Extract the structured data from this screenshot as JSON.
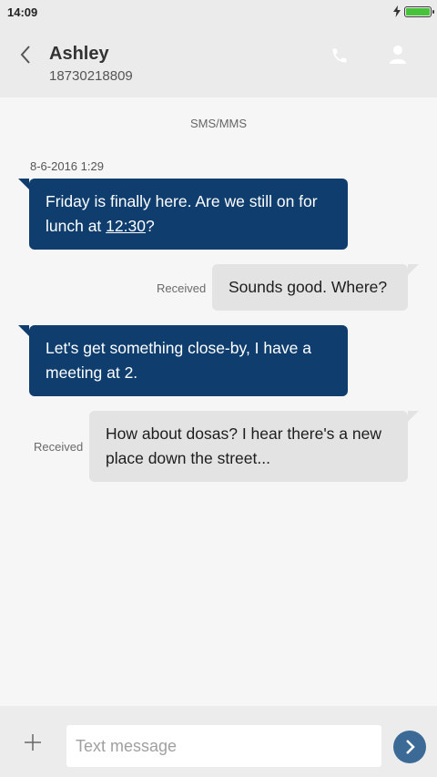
{
  "status_bar": {
    "time": "14:09",
    "battery_color": "#47c23a"
  },
  "header": {
    "contact_name": "Ashley",
    "contact_number": "18730218809",
    "icons": [
      "back-icon",
      "call-icon",
      "profile-icon"
    ]
  },
  "conversation": {
    "channel": "SMS/MMS",
    "timestamp": "8-6-2016 1:29",
    "messages": [
      {
        "direction": "outgoing",
        "text_before": "Friday is finally here. Are we still on for lunch at ",
        "link": "12:30",
        "text_after": "?"
      },
      {
        "direction": "incoming",
        "status": "Received",
        "text": "Sounds good. Where?"
      },
      {
        "direction": "outgoing",
        "text": "Let's get something close-by, I have a meeting at 2."
      },
      {
        "direction": "incoming",
        "status": "Received",
        "text": "How about dosas? I hear there's a new place down the street..."
      }
    ],
    "colors": {
      "outgoing_bubble": "#0f3e6e",
      "incoming_bubble": "#e3e3e3"
    }
  },
  "compose": {
    "placeholder": "Text message",
    "icons": [
      "plus-icon",
      "send-icon"
    ],
    "send_color": "#3b6a96"
  }
}
